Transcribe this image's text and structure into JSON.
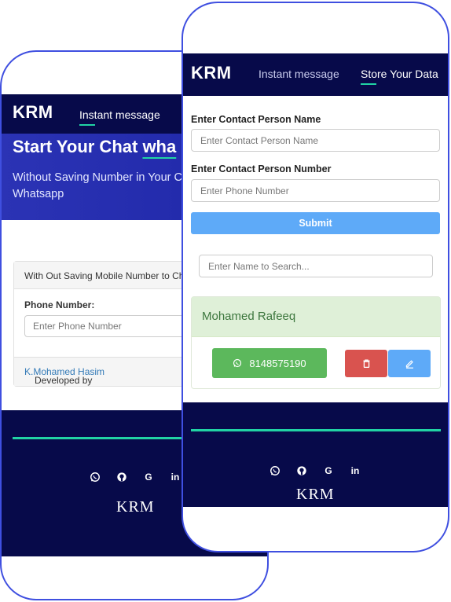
{
  "back": {
    "logo": "KRM",
    "nav": {
      "instant_message": "Instant message"
    },
    "hero": {
      "title_start": "Start Your Chat ",
      "title_em": "wha",
      "subtitle": "Without Saving Number in Your Chat on Whatsapp"
    },
    "card": {
      "header": "With Out Saving Mobile Number to Ch",
      "phone_label": "Phone Number:",
      "phone_placeholder": "Enter Phone Number",
      "footer_prefix": "Developed by ",
      "footer_author": "K.Mohamed Hasim"
    },
    "footer": {
      "brand": "KRM"
    }
  },
  "front": {
    "logo": "KRM",
    "nav": {
      "instant_message": "Instant message",
      "store_data": "Store Your Data"
    },
    "form": {
      "name_label": "Enter Contact Person Name",
      "name_placeholder": "Enter Contact Person Name",
      "number_label": "Enter Contact Person Number",
      "number_placeholder": "Enter Phone Number",
      "submit": "Submit"
    },
    "search_placeholder": "Enter Name to Search...",
    "contact": {
      "name": "Mohamed Rafeeq",
      "phone": "8148575190"
    },
    "footer": {
      "brand": "KRM"
    }
  },
  "social_icons": [
    "whatsapp-icon",
    "github-icon",
    "google-icon",
    "linkedin-icon"
  ],
  "colors": {
    "nav": "#070a4a",
    "accent": "#21d3a4",
    "primary": "#5eaaf8",
    "success": "#5cb85c",
    "danger": "#d9534f",
    "frame": "#3f4fe0"
  }
}
